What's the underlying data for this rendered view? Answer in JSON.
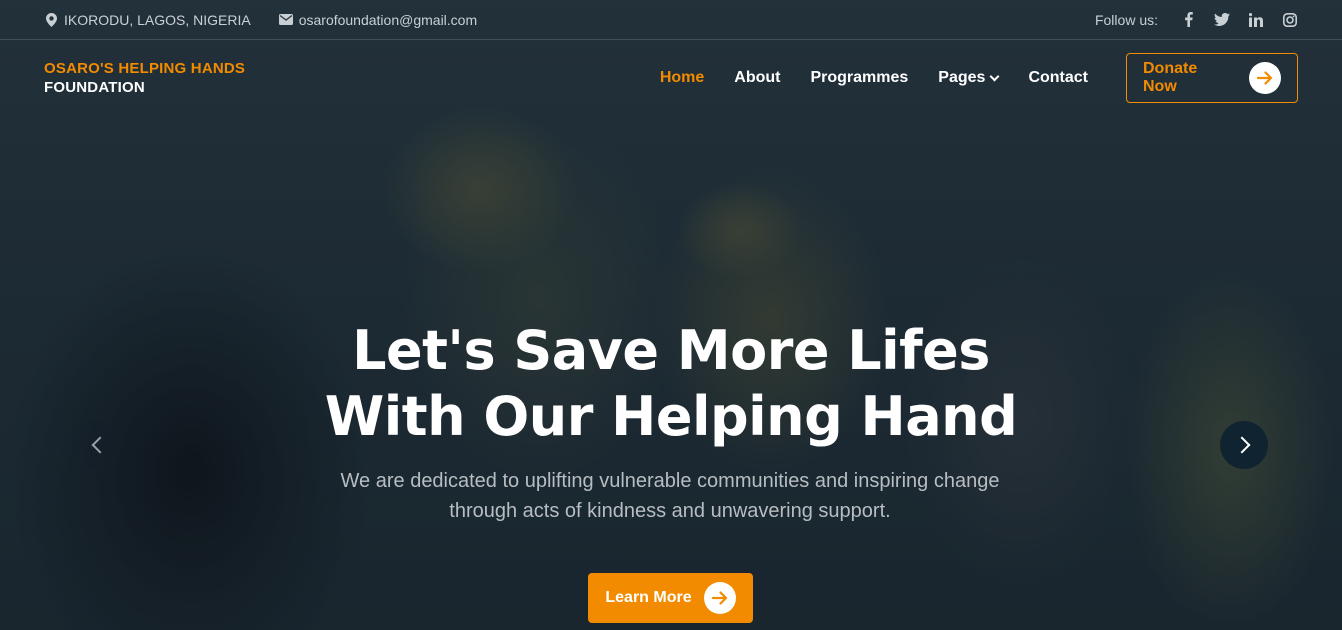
{
  "topbar": {
    "location": "IKORODU, LAGOS, NIGERIA",
    "email": "osarofoundation@gmail.com",
    "follow_label": "Follow us:",
    "social_icons": [
      "facebook-icon",
      "twitter-icon",
      "linkedin-icon",
      "instagram-icon"
    ]
  },
  "brand": {
    "line1": "OSARO'S HELPING HANDS",
    "line2": "FOUNDATION"
  },
  "nav": {
    "items": [
      {
        "label": "Home",
        "active": true
      },
      {
        "label": "About"
      },
      {
        "label": "Programmes"
      },
      {
        "label": "Pages",
        "has_dropdown": true
      },
      {
        "label": "Contact"
      }
    ],
    "donate_label": "Donate Now"
  },
  "hero": {
    "title_line1": "Let's Save More Lifes",
    "title_line2": "With Our Helping Hand",
    "subtitle": "We are dedicated to uplifting vulnerable communities and inspiring change through acts of kindness and unwavering support.",
    "cta_label": "Learn More"
  },
  "colors": {
    "accent": "#f28b00",
    "overlay": "#1d2a33"
  }
}
